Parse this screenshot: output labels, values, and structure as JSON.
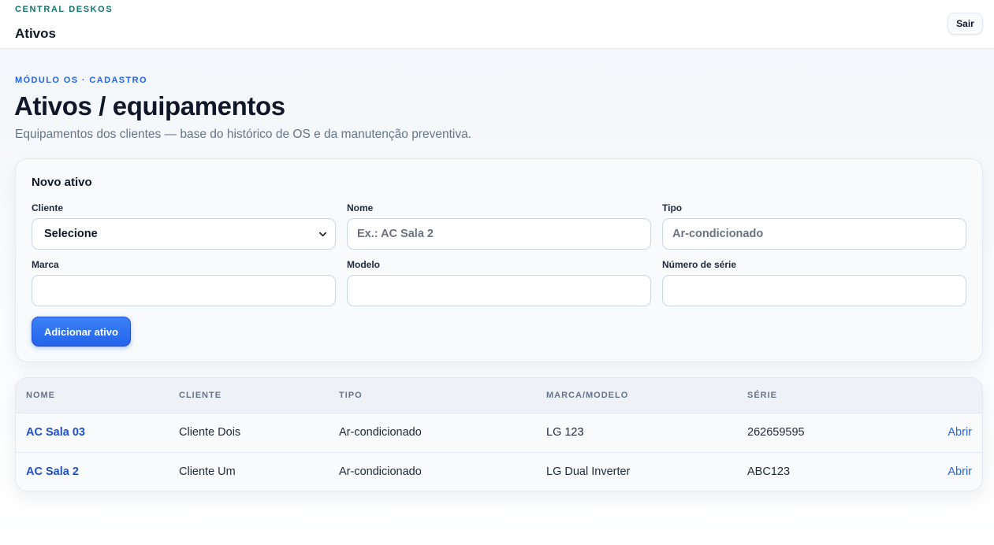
{
  "header": {
    "brand": "CENTRAL DESKOS",
    "title": "Ativos",
    "logout_label": "Sair"
  },
  "page": {
    "kicker": "MÓDULO OS · CADASTRO",
    "title": "Ativos / equipamentos",
    "subtitle": "Equipamentos dos clientes — base do histórico de OS e da manutenção preventiva."
  },
  "form": {
    "title": "Novo ativo",
    "client": {
      "label": "Cliente",
      "value": "Selecione"
    },
    "name": {
      "label": "Nome",
      "placeholder": "Ex.: AC Sala 2",
      "value": ""
    },
    "type": {
      "label": "Tipo",
      "placeholder": "Ar-condicionado",
      "value": ""
    },
    "brand": {
      "label": "Marca",
      "value": ""
    },
    "model": {
      "label": "Modelo",
      "value": ""
    },
    "serial": {
      "label": "Número de série",
      "value": ""
    },
    "submit_label": "Adicionar ativo"
  },
  "table": {
    "columns": [
      "NOME",
      "CLIENTE",
      "TIPO",
      "MARCA/MODELO",
      "SÉRIE"
    ],
    "rows": [
      {
        "name": "AC Sala 03",
        "client": "Cliente Dois",
        "type": "Ar-condicionado",
        "brand_model": "LG 123",
        "serial": "262659595",
        "action": "Abrir"
      },
      {
        "name": "AC Sala 2",
        "client": "Cliente Um",
        "type": "Ar-condicionado",
        "brand_model": "LG Dual Inverter",
        "serial": "ABC123",
        "action": "Abrir"
      }
    ]
  },
  "colors": {
    "brand": "#0f766e",
    "accent": "#2563eb",
    "text": "#0f172a",
    "muted": "#64748b"
  },
  "icons": {
    "select_chevron": "chevron-down-icon"
  }
}
